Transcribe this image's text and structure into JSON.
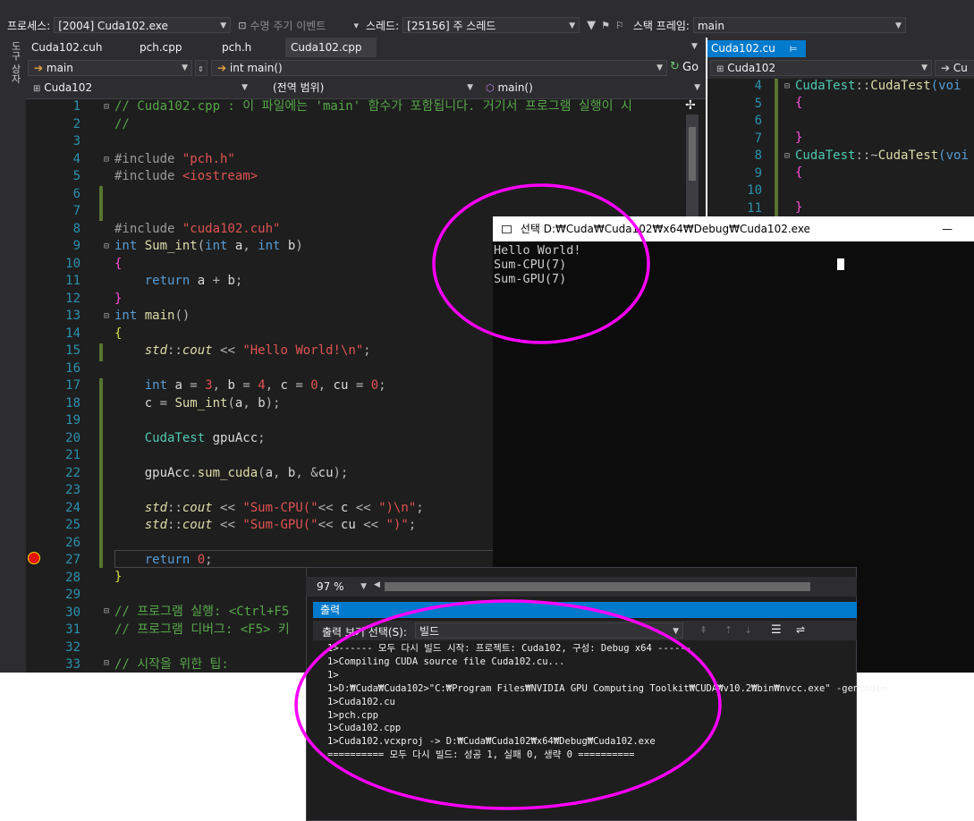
{
  "debug_toolbar": {
    "process_label": "프로세스:",
    "process_value": "[2004] Cuda102.exe",
    "lifecycle_label": "수명 주기 이벤트",
    "thread_label": "스레드:",
    "thread_value": "[25156] 주 스레드",
    "stackframe_label": "스택 프레임:",
    "stackframe_value": "main"
  },
  "toolstrip": {
    "label": "도구 상자"
  },
  "editor": {
    "tabs": [
      "Cuda102.cuh",
      "pch.cpp",
      "pch.h",
      "Cuda102.cpp"
    ],
    "active_tab": "Cuda102.cpp",
    "nav_scope": "main",
    "nav_func": "int main()",
    "go_label": "Go",
    "project": "Cuda102",
    "global_scope": "(전역 범위)",
    "member": "main()",
    "line_numbers": [
      "1",
      "2",
      "3",
      "4",
      "5",
      "6",
      "7",
      "8",
      "9",
      "10",
      "11",
      "12",
      "13",
      "14",
      "15",
      "16",
      "17",
      "18",
      "19",
      "20",
      "21",
      "22",
      "23",
      "24",
      "25",
      "26",
      "27",
      "28",
      "29",
      "30",
      "31",
      "32",
      "33"
    ],
    "lines": {
      "l1": "// Cuda102.cpp : 이 파일에는 'main' 함수가 포함됩니다. 거기서 프로그램 실행이 시",
      "l2": "//",
      "l4a": "#include ",
      "l4b": "\"pch.h\"",
      "l5a": "#include ",
      "l5b": "<iostream>",
      "l8a": "#include ",
      "l8b": "\"cuda102.cuh\"",
      "l9a": "int ",
      "l9b": "Sum_int",
      "l9c": "(",
      "l9d": "int ",
      "l9e": "a",
      "l9f": ", ",
      "l9g": "int ",
      "l9h": "b",
      "l9i": ")",
      "l10": "{",
      "l11a": "    return ",
      "l11b": "a",
      "l11c": " + ",
      "l11d": "b",
      "l11e": ";",
      "l12": "}",
      "l13a": "int ",
      "l13b": "main",
      "l13c": "()",
      "l14": "{",
      "l15a": "    std",
      "l15b": "::",
      "l15c": "cout",
      "l15d": " << ",
      "l15e": "\"Hello World!\\n\"",
      "l15f": ";",
      "l17a": "    int ",
      "l17b": "a",
      "l17c": " = ",
      "l17d": "3",
      "l17e": ", ",
      "l17f": "b",
      "l17g": " = ",
      "l17h": "4",
      "l17i": ", ",
      "l17j": "c",
      "l17k": " = ",
      "l17l": "0",
      "l17m": ", ",
      "l17n": "cu",
      "l17o": " = ",
      "l17p": "0",
      "l17q": ";",
      "l18a": "    c",
      "l18b": " = ",
      "l18c": "Sum_int",
      "l18d": "(",
      "l18e": "a",
      "l18f": ", ",
      "l18g": "b",
      "l18h": ");",
      "l20a": "    CudaTest ",
      "l20b": "gpuAcc",
      "l20c": ";",
      "l22a": "    gpuAcc",
      "l22b": ".",
      "l22c": "sum_cuda",
      "l22d": "(",
      "l22e": "a",
      "l22f": ", ",
      "l22g": "b",
      "l22h": ", &",
      "l22i": "cu",
      "l22j": ");",
      "l24a": "    std",
      "l24b": "::",
      "l24c": "cout",
      "l24d": " << ",
      "l24e": "\"Sum-CPU(\"",
      "l24f": "<< ",
      "l24g": "c",
      "l24h": " << ",
      "l24i": "\")\\n\"",
      "l24j": ";",
      "l25a": "    std",
      "l25b": "::",
      "l25c": "cout",
      "l25d": " << ",
      "l25e": "\"Sum-GPU(\"",
      "l25f": "<< ",
      "l25g": "cu",
      "l25h": " << ",
      "l25i": "\")\"",
      "l25j": ";",
      "l27a": "    return ",
      "l27b": "0",
      "l27c": ";",
      "l28": "}",
      "l30": "// 프로그램 실행: <Ctrl+F5",
      "l31": "// 프로그램 디버그: <F5> 키",
      "l33": "// 시작을 위한 팁:"
    }
  },
  "right_editor": {
    "tab": "Cuda102.cu",
    "pin": "⊨",
    "close": "✕",
    "project": "Cuda102",
    "nav_right": "Cu",
    "line_numbers": [
      "4",
      "5",
      "6",
      "7",
      "8",
      "9",
      "10",
      "11"
    ],
    "lines": {
      "r4a": "CudaTest",
      "r4b": "::",
      "r4c": "CudaTest",
      "r4d": "(voi",
      "r5": "{",
      "r7": "}",
      "r8a": "CudaTest",
      "r8b": "::~",
      "r8c": "CudaTest",
      "r8d": "(voi",
      "r9": "{",
      "r11": "}"
    }
  },
  "console": {
    "title": "선택 D:₩Cuda₩Cuda102₩x64₩Debug₩Cuda102.exe",
    "minimize": "—",
    "output": "Hello World!\nSum-CPU(7)\nSum-GPU(7)"
  },
  "output_panel": {
    "zoom": "97 %",
    "title": "출력",
    "source_label": "출력 보기 선택(S):",
    "source_value": "빌드",
    "text": "1>------ 모두 다시 빌드 시작: 프로젝트: Cuda102, 구성: Debug x64 ------\n1>Compiling CUDA source file Cuda102.cu...\n1>\n1>D:₩Cuda₩Cuda102>\"C:₩Program Files₩NVIDIA GPU Computing Toolkit₩CUDA₩v10.2₩bin₩nvcc.exe\" -gencode=\n1>Cuda102.cu\n1>pch.cpp\n1>Cuda102.cpp\n1>Cuda102.vcxproj -> D:₩Cuda₩Cuda102₩x64₩Debug₩Cuda102.exe\n========== 모두 다시 빌드: 성공 1, 실패 0, 생략 0 =========="
  },
  "colors": {
    "editor_bg": "#1e1e1e",
    "accent": "#007acc",
    "annotation": "#ff00ff"
  }
}
